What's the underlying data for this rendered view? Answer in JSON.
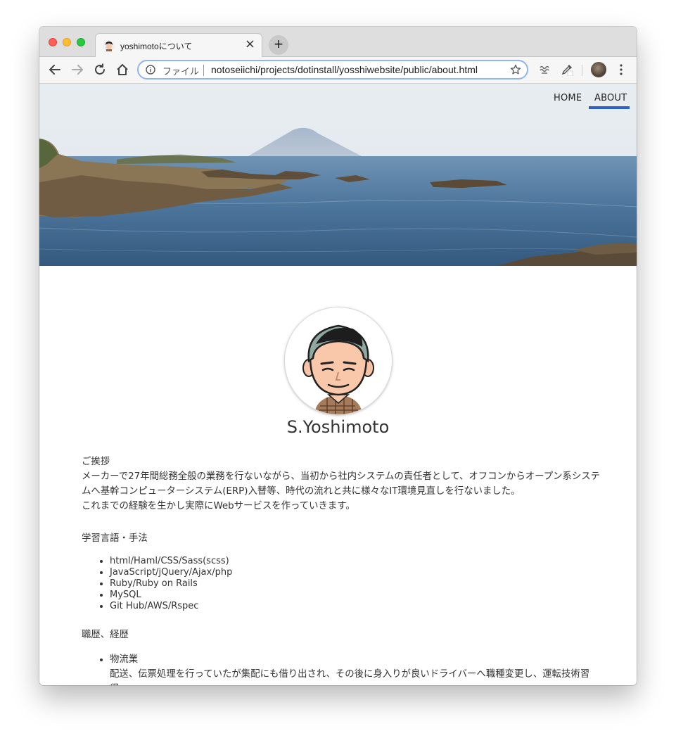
{
  "browser": {
    "tab": {
      "title": "yoshimotoについて",
      "close": "×"
    },
    "new_tab": "+",
    "omnibox": {
      "scheme_label": "ファイル",
      "url": "notoseiichi/projects/dotinstall/yosshiwebsite/public/about.html"
    }
  },
  "nav": {
    "home": "HOME",
    "about": "ABOUT",
    "active": "ABOUT"
  },
  "profile": {
    "name": "S.Yoshimoto"
  },
  "greeting": {
    "heading": "ご挨拶",
    "lines": [
      "メーカーで27年間総務全般の業務を行ないながら、当初から社内システムの責任者として、オフコンからオープン系システムへ基幹コンピューターシステム(ERP)入替等、時代の流れと共に様々なIT環境見直しを行ないました。",
      "これまでの経験を生かし実際にWebサービスを作っていきます。"
    ]
  },
  "skills": {
    "heading": "学習言語・手法",
    "items": [
      "html/Haml/CSS/Sass(scss)",
      "JavaScript/jQuery/Ajax/php",
      "Ruby/Ruby on Rails",
      "MySQL",
      "Git Hub/AWS/Rspec"
    ]
  },
  "career": {
    "heading": "職歴、経歴",
    "items": [
      {
        "title": "物流業",
        "detail": "配送、伝票処理を行っていたが集配にも借り出され、その後に身入りが良いドライバーへ職種変更し、運転技術習得。"
      }
    ]
  },
  "colors": {
    "nav_underline": "#2f5fc9",
    "omnibox_border": "#8fb4f1",
    "text": "#333333"
  }
}
